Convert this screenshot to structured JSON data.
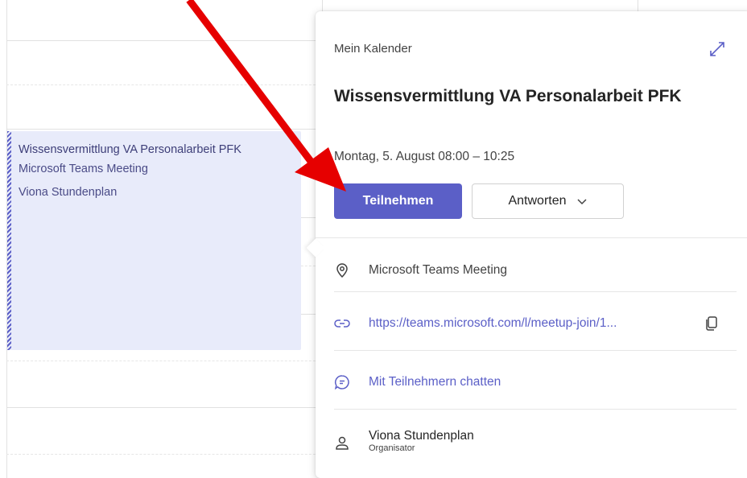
{
  "calendar": {
    "event": {
      "title": "Wissensvermittlung VA Personalarbeit PFK",
      "location": "Microsoft Teams Meeting",
      "organizer": "Viona Stundenplan"
    }
  },
  "popup": {
    "calendar_name": "Mein Kalender",
    "title": "Wissensvermittlung VA Personalarbeit PFK",
    "datetime": "Montag, 5. August 08:00 – 10:25",
    "join_label": "Teilnehmen",
    "respond_label": "Antworten",
    "location": "Microsoft Teams Meeting",
    "link": "https://teams.microsoft.com/l/meetup-join/1...",
    "chat_label": "Mit Teilnehmern chatten",
    "organizer_name": "Viona Stundenplan",
    "organizer_role": "Organisator"
  },
  "colors": {
    "accent": "#5b5fc7",
    "event_bg": "#e8ebfa",
    "annotation_arrow": "#e60000"
  },
  "icons": {
    "expand": "expand-icon",
    "location": "location-pin-icon",
    "link": "link-icon",
    "copy": "copy-icon",
    "chat": "chat-icon",
    "person": "person-icon",
    "chevron": "chevron-down-icon"
  }
}
